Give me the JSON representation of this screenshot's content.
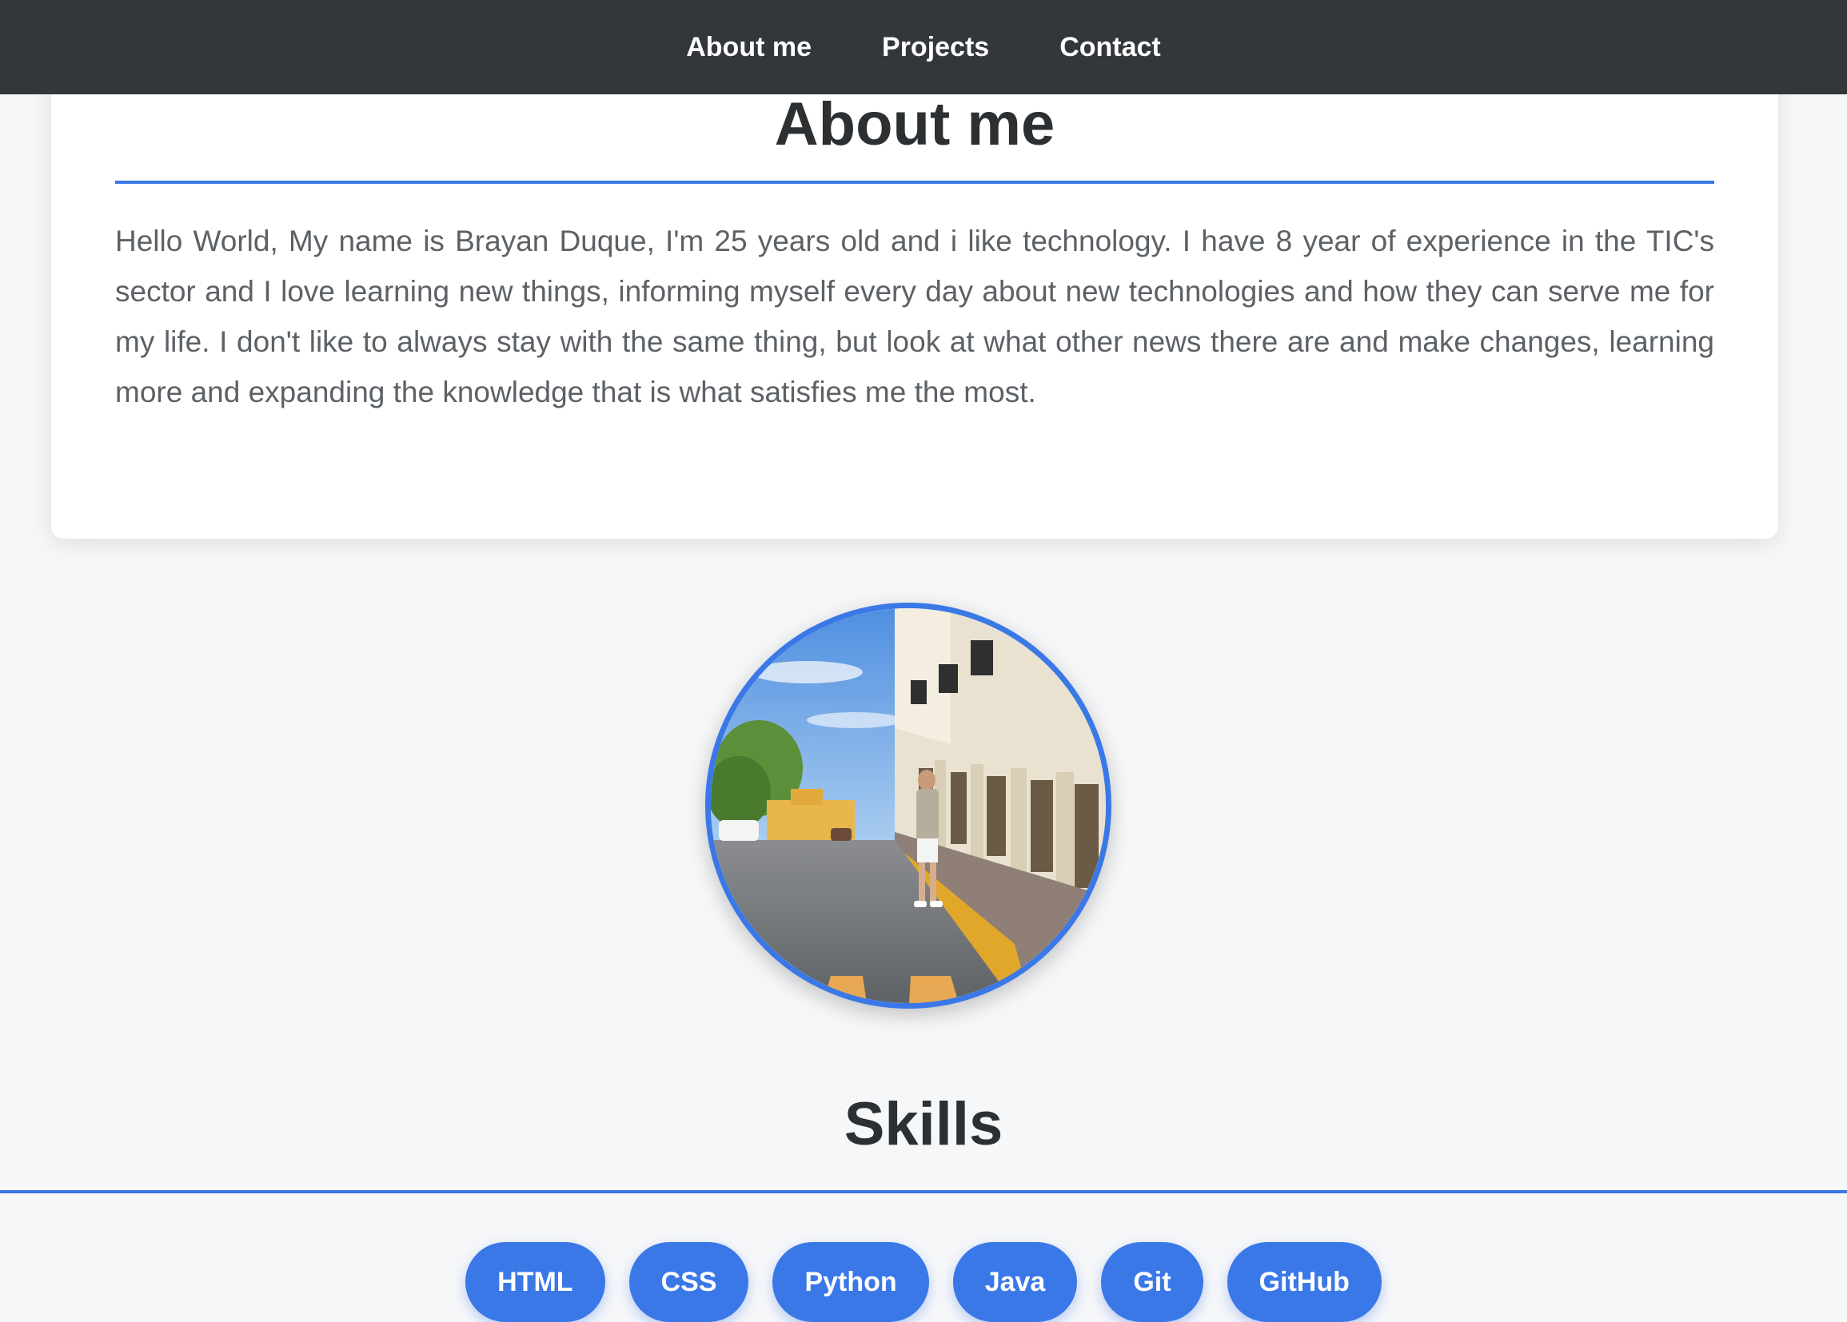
{
  "nav": {
    "items": [
      {
        "label": "About me"
      },
      {
        "label": "Projects"
      },
      {
        "label": "Contact"
      }
    ]
  },
  "about": {
    "title": "About me",
    "text": "Hello World, My name is Brayan Duque, I'm 25 years old and i like technology. I have 8 year of experience in the TIC's sector and I love learning new things, informing myself every day about new technologies and how they can serve me for my life. I don't like to always stay with the same thing, but look at what other news there are and make changes, learning more and expanding the knowledge that is what satisfies me the most."
  },
  "skills": {
    "title": "Skills",
    "items": [
      "HTML",
      "CSS",
      "Python",
      "Java",
      "Git",
      "GitHub"
    ]
  },
  "colors": {
    "accent": "#3b78e7",
    "navbar": "#33373b",
    "background": "#f6f7f9",
    "heading": "#2c3033",
    "body_text": "#5c6166"
  }
}
